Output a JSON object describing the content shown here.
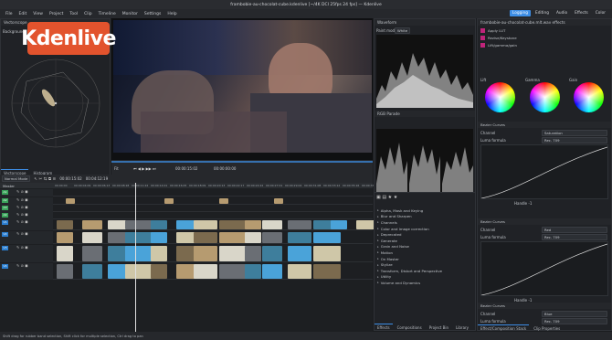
{
  "window": {
    "title": "frambobie-au-chocolat-cube.kdenlive [~/4K DCI 25fps 24 fps] — Kdenlive"
  },
  "menu": [
    "File",
    "Edit",
    "View",
    "Project",
    "Tool",
    "Clip",
    "Timeline",
    "Monitor",
    "Settings",
    "Help"
  ],
  "layouts": [
    {
      "label": "Logging",
      "active": true
    },
    {
      "label": "Editing",
      "active": false
    },
    {
      "label": "Audio",
      "active": false
    },
    {
      "label": "Effects",
      "active": false
    },
    {
      "label": "Color",
      "active": false
    }
  ],
  "logo": {
    "text": "Kdenlive",
    "color": "#e2532d"
  },
  "left_panel": {
    "title": "Vectorscope",
    "tabs": [
      "Vectorscope",
      "Histogram"
    ],
    "labels": [
      "Background"
    ]
  },
  "monitor": {
    "timecode_in": "00:00:15:02",
    "timecode_out": "00:00:00:00",
    "zoom": "Fit"
  },
  "timeline": {
    "toolbar_mode": "Normal Mode",
    "timecode_a": "00:00:15:02",
    "timecode_b": "00:04:12:19",
    "master": "Master",
    "ruler": [
      "00:00:00",
      "00:00:04:09",
      "00:00:06:13",
      "00:00:08:18",
      "00:00:11:22",
      "00:00:14:01",
      "00:00:16:05",
      "00:00:18:09",
      "00:00:20:13",
      "00:00:22:17",
      "00:00:24:22",
      "00:00:27:01",
      "00:00:29:04",
      "00:00:31:08",
      "00:00:33:12",
      "00:00:35:16",
      "00:00:37:19"
    ],
    "tracks": [
      {
        "name": "A1"
      },
      {
        "name": "A2"
      },
      {
        "name": "A3"
      },
      {
        "name": "A4"
      },
      {
        "name": "V1"
      },
      {
        "name": "V2"
      },
      {
        "name": "V3"
      },
      {
        "name": "V4"
      }
    ]
  },
  "scopes": {
    "waveform": "Waveform",
    "rgb": "RGB Parade",
    "paint_mode": "Paint mode",
    "white": "White"
  },
  "effects_list": {
    "items": [
      "Alpha, Mask and Keying",
      "Blur and Sharpen",
      "Channels",
      "Color and Image correction",
      "Deprecated",
      "Generate",
      "Grain and Noise",
      "Motion",
      "On Master",
      "Stylize",
      "Transform, Distort and Perspective",
      "Utility",
      "Volume and Dynamics"
    ],
    "tabs": [
      "Effects",
      "Compositions",
      "Project Bin",
      "Library"
    ]
  },
  "effect_stack": {
    "title": "frambobie-au-chocolat-cube.mlt.wav effects",
    "effects": [
      "Apply LUT",
      "Rezise/Keystone",
      "Lift/gamma/gain"
    ],
    "wheels": [
      "Lift",
      "Gamma",
      "Gain"
    ],
    "curves": [
      {
        "name": "Bezier Curves",
        "channel": "Saturation",
        "mode": "Luma formula",
        "formula": "Rec. 709"
      },
      {
        "name": "Bezier Curves",
        "channel": "Red",
        "mode": "Luma formula",
        "formula": "Rec. 709"
      },
      {
        "name": "Bezier Curves",
        "channel": "Blue",
        "mode": "Luma formula",
        "formula": "Rec. 709"
      }
    ],
    "handles": [
      "Handle -1",
      "Handle -2"
    ],
    "tabs": [
      "Effect/Composition Stack",
      "Clip Properties"
    ]
  },
  "status": "Shift drag for rubber band selection, Shift click for multiple selection, Ctrl drag to pan"
}
